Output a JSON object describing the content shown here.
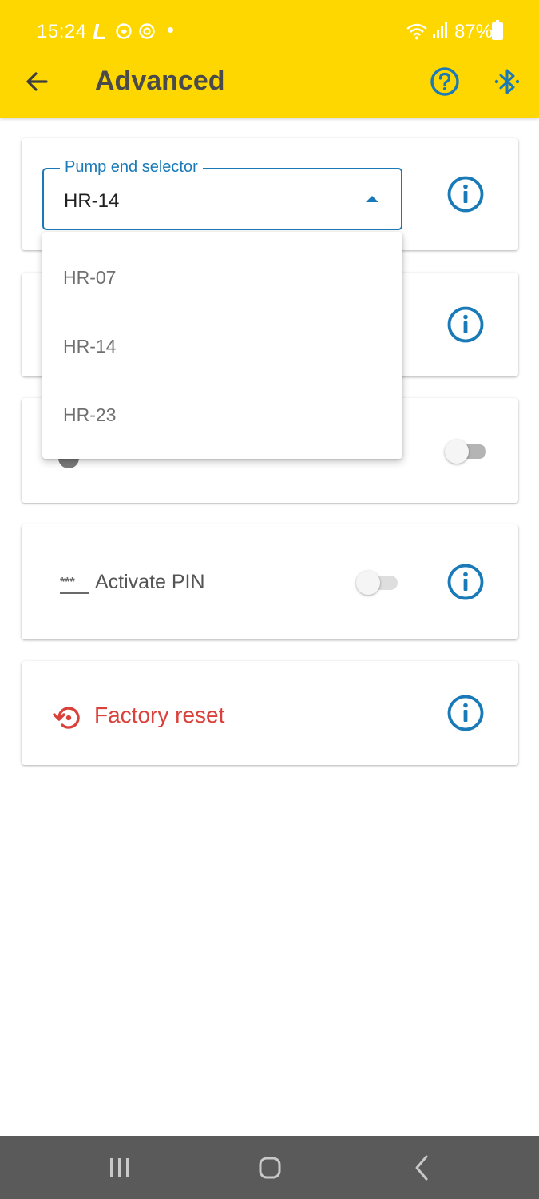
{
  "status_bar": {
    "time": "15:24",
    "app_icon_letter": "L",
    "battery_percent": "87%"
  },
  "app_bar": {
    "title": "Advanced",
    "background_color": "#fed600",
    "icons": [
      "back-arrow-icon",
      "help-icon",
      "bluetooth-icon"
    ]
  },
  "pump_end_card": {
    "label": "Pump end selector",
    "value": "HR-14",
    "expanded": true
  },
  "dropdown": {
    "options": [
      "HR-07",
      "HR-14",
      "HR-23"
    ]
  },
  "toggle_card": {
    "on": false
  },
  "pin_card": {
    "icon_text": "***",
    "label": "Activate PIN",
    "on": false
  },
  "reset_card": {
    "label": "Factory reset",
    "color": "#d9413a"
  },
  "colors": {
    "accent": "#1a7ab8"
  }
}
